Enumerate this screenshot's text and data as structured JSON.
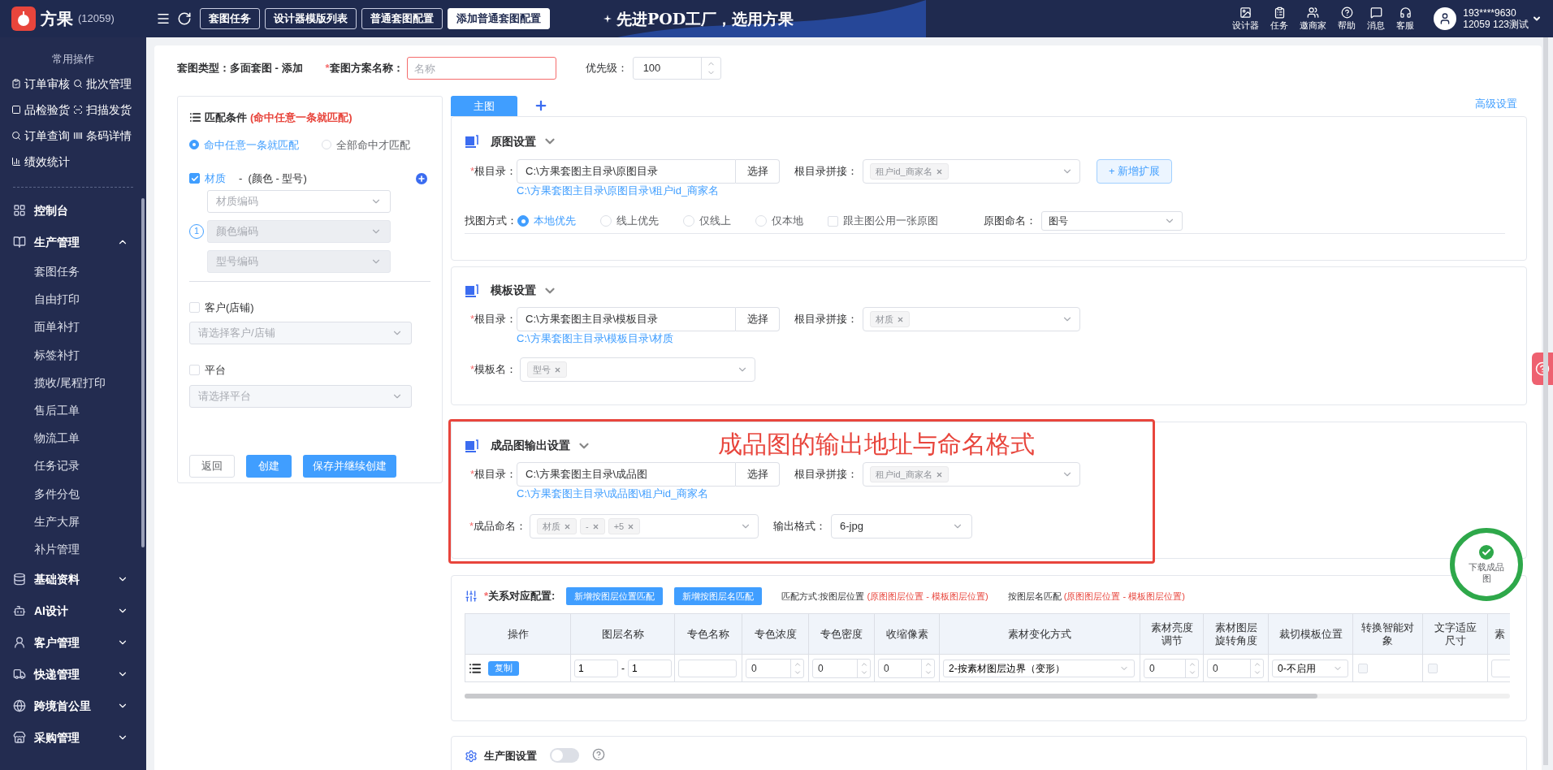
{
  "header": {
    "logo": {
      "name": "方果",
      "code": "(12059)"
    },
    "nav_tabs": [
      {
        "label": "套图任务",
        "selected": false
      },
      {
        "label": "设计器模版列表",
        "selected": false
      },
      {
        "label": "普通套图配置",
        "selected": false
      },
      {
        "label": "添加普通套图配置",
        "selected": true
      }
    ],
    "slogan": "先进POD工厂，选用方果",
    "tools": [
      "设计器",
      "任务",
      "邀商家",
      "帮助",
      "消息",
      "客服"
    ],
    "user": {
      "phone": "193****9630",
      "account": "12059 123测试"
    }
  },
  "sidebar": {
    "quick_title": "常用操作",
    "quick_actions": [
      "订单审核",
      "批次管理",
      "品检验货",
      "扫描发货",
      "订单查询",
      "条码详情",
      "绩效统计"
    ],
    "menu": [
      {
        "label": "控制台",
        "kind": "link"
      },
      {
        "label": "生产管理",
        "kind": "group",
        "expanded": true,
        "children": [
          {
            "label": "套图任务"
          },
          {
            "label": "自由打印"
          },
          {
            "label": "面单补打"
          },
          {
            "label": "标签补打"
          },
          {
            "label": "揽收/尾程打印"
          },
          {
            "label": "售后工单"
          },
          {
            "label": "物流工单"
          },
          {
            "label": "任务记录"
          },
          {
            "label": "多件分包"
          },
          {
            "label": "生产大屏"
          },
          {
            "label": "补片管理"
          }
        ]
      },
      {
        "label": "基础资料",
        "kind": "group",
        "expanded": false
      },
      {
        "label": "AI设计",
        "kind": "group",
        "expanded": false
      },
      {
        "label": "客户管理",
        "kind": "group",
        "expanded": false
      },
      {
        "label": "快递管理",
        "kind": "group",
        "expanded": false
      },
      {
        "label": "跨境首公里",
        "kind": "group",
        "expanded": false
      },
      {
        "label": "采购管理",
        "kind": "group",
        "expanded": false
      }
    ]
  },
  "form": {
    "type_text": "套图类型：多面套图 - 添加",
    "name_field": {
      "mark": "*",
      "label": "套图方案名称：",
      "placeholder": "名称"
    },
    "priority": {
      "label": "优先级：",
      "value": "100"
    }
  },
  "match_panel": {
    "title": "匹配条件",
    "hint": "(命中任意一条就匹配)",
    "modes": [
      {
        "label": "命中任意一条就匹配",
        "selected": true
      },
      {
        "label": "全部命中才匹配",
        "selected": false
      }
    ],
    "material": {
      "checked": true,
      "label": "材质",
      "suffix": "-  (颜色 - 型号)",
      "badge": "1",
      "selects": [
        {
          "placeholder": "材质编码",
          "disabled": false
        },
        {
          "placeholder": "颜色编码",
          "disabled": true
        },
        {
          "placeholder": "型号编码",
          "disabled": true
        }
      ]
    },
    "filters": [
      {
        "label": "客户(店铺)",
        "checked": false,
        "placeholder": "请选择客户/店铺"
      },
      {
        "label": "平台",
        "checked": false,
        "placeholder": "请选择平台"
      }
    ],
    "buttons": [
      {
        "label": "返回",
        "kind": "default"
      },
      {
        "label": "创建",
        "kind": "primary"
      },
      {
        "label": "保存并继续创建",
        "kind": "primary"
      }
    ]
  },
  "image_tabs": [
    {
      "label": "主图",
      "selected": true
    }
  ],
  "advanced_link": "高级设置",
  "sections": [
    {
      "title": "原图设置",
      "root": {
        "mark": "*",
        "label": "根目录：",
        "value": "C:\\方果套图主目录\\原图目录",
        "button": "选择",
        "path": "C:\\方果套图主目录\\原图目录\\租户id_商家名"
      },
      "join": {
        "label": "根目录拼接：",
        "tags": [
          "租户id_商家名"
        ]
      },
      "extend_button": "+ 新增扩展",
      "search": {
        "label": "找图方式：",
        "options": [
          {
            "label": "本地优先",
            "selected": true
          },
          {
            "label": "线上优先",
            "selected": false
          },
          {
            "label": "仅线上",
            "selected": false
          },
          {
            "label": "仅本地",
            "selected": false
          }
        ],
        "share": {
          "label": "跟主图公用一张原图",
          "checked": false
        },
        "naming": {
          "label": "原图命名：",
          "value": "图号"
        }
      }
    },
    {
      "title": "模板设置",
      "root": {
        "mark": "*",
        "label": "根目录：",
        "value": "C:\\方果套图主目录\\模板目录",
        "button": "选择",
        "path": "C:\\方果套图主目录\\模板目录\\材质"
      },
      "join": {
        "label": "根目录拼接：",
        "tags": [
          "材质"
        ]
      },
      "template": {
        "mark": "*",
        "label": "模板名：",
        "tags": [
          "型号"
        ]
      }
    },
    {
      "title": "成品图输出设置",
      "root": {
        "mark": "*",
        "label": "根目录：",
        "value": "C:\\方果套图主目录\\成品图",
        "button": "选择",
        "path": "C:\\方果套图主目录\\成品图\\租户id_商家名"
      },
      "join": {
        "label": "根目录拼接：",
        "tags": [
          "租户id_商家名"
        ]
      },
      "output": {
        "mark": "*",
        "label": "成品命名：",
        "tags": [
          "材质",
          "-",
          "+5"
        ],
        "format_label": "输出格式：",
        "format": "6-jpg"
      },
      "annotation": "成品图的输出地址与命名格式"
    }
  ],
  "relations": {
    "mark": "*",
    "title": "关系对应配置:",
    "buttons": [
      "新增按图层位置匹配",
      "新增按图层名匹配"
    ],
    "notes": [
      {
        "label": "匹配方式:按图层位置",
        "detail": "(原图图层位置 - 模板图层位置)"
      },
      {
        "label": "按图层名匹配",
        "detail": "(原图图层位置 - 模板图层位置)"
      }
    ],
    "table": {
      "columns": [
        "操作",
        "图层名称",
        "专色名称",
        "专色浓度",
        "专色密度",
        "收缩像素",
        "素材变化方式",
        "素材亮度调节",
        "素材图层旋转角度",
        "裁切模板位置",
        "转换智能对象",
        "文字适应尺寸",
        "素"
      ],
      "rows": [
        {
          "copy": "复制",
          "layer_from": "1",
          "separator": "-",
          "layer_to": "1",
          "spot_name": "",
          "spot_concentration": "0",
          "spot_density": "0",
          "shrink": "0",
          "transform": "2-按素材图层边界（变形）",
          "brightness": "0",
          "rotation": "0",
          "crop": "0-不启用",
          "smart_object": false,
          "fit_text": false
        }
      ]
    }
  },
  "production": {
    "title": "生产图设置",
    "on": false
  },
  "download_badge": "下载成品图"
}
